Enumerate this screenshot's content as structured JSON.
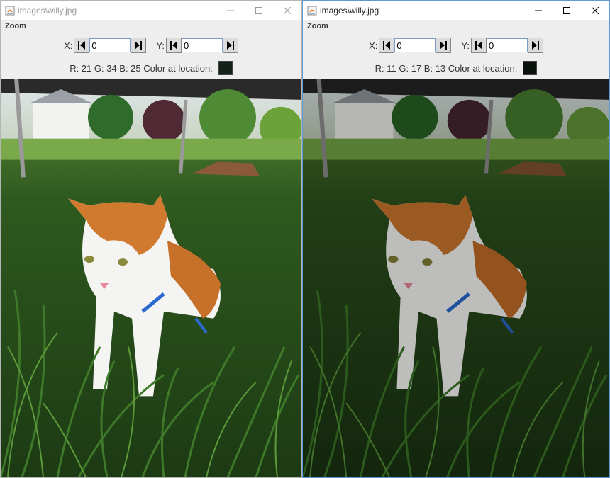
{
  "windows": [
    {
      "title": "images\\willy.jpg",
      "menu": "Zoom",
      "x_label": "X:",
      "x_value": "0",
      "y_label": "Y:",
      "y_value": "0",
      "color_text": "R: 21  G: 34  B: 25  Color at location:",
      "swatch_color": "#152219",
      "active": false
    },
    {
      "title": "images\\willy.jpg",
      "menu": "Zoom",
      "x_label": "X:",
      "x_value": "0",
      "y_label": "Y:",
      "y_value": "0",
      "color_text": "R: 11  G: 17  B: 13  Color at location:",
      "swatch_color": "#0b110d",
      "active": true
    }
  ],
  "icons": {
    "app": "java-app-icon",
    "minimize": "minimize-icon",
    "maximize": "maximize-icon",
    "close": "close-icon",
    "left": "arrow-left-icon",
    "right": "arrow-right-icon"
  }
}
